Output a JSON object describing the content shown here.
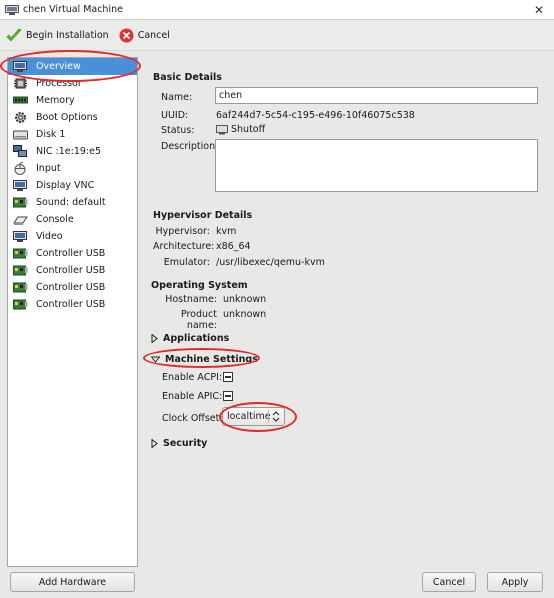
{
  "window": {
    "title": "chen Virtual Machine"
  },
  "toolbar": {
    "begin_label": "Begin Installation",
    "cancel_label": "Cancel"
  },
  "sidebar": {
    "items": [
      {
        "label": "Overview",
        "icon": "monitor-icon"
      },
      {
        "label": "Processor",
        "icon": "cpu-icon"
      },
      {
        "label": "Memory",
        "icon": "memory-icon"
      },
      {
        "label": "Boot Options",
        "icon": "gear-icon"
      },
      {
        "label": "Disk 1",
        "icon": "disk-icon"
      },
      {
        "label": "NIC :1e:19:e5",
        "icon": "network-icon"
      },
      {
        "label": "Input",
        "icon": "mouse-icon"
      },
      {
        "label": "Display VNC",
        "icon": "display-icon"
      },
      {
        "label": "Sound: default",
        "icon": "sound-card-icon"
      },
      {
        "label": "Console",
        "icon": "console-icon"
      },
      {
        "label": "Video",
        "icon": "video-icon"
      },
      {
        "label": "Controller USB",
        "icon": "usb-controller-icon"
      },
      {
        "label": "Controller USB",
        "icon": "usb-controller-icon"
      },
      {
        "label": "Controller USB",
        "icon": "usb-controller-icon"
      },
      {
        "label": "Controller USB",
        "icon": "usb-controller-icon"
      }
    ],
    "add_hardware_label": "Add Hardware"
  },
  "basic": {
    "header": "Basic Details",
    "name_label": "Name:",
    "name_value": "chen",
    "uuid_label": "UUID:",
    "uuid_value": "6af244d7-5c54-c195-e496-10f46075c538",
    "status_label": "Status:",
    "status_value": "Shutoff",
    "description_label": "Description:",
    "description_value": ""
  },
  "hypervisor": {
    "header": "Hypervisor Details",
    "hypervisor_label": "Hypervisor:",
    "hypervisor_value": "kvm",
    "arch_label": "Architecture:",
    "arch_value": "x86_64",
    "emulator_label": "Emulator:",
    "emulator_value": "/usr/libexec/qemu-kvm"
  },
  "os": {
    "header": "Operating System",
    "hostname_label": "Hostname:",
    "hostname_value": "unknown",
    "product_label": "Product name:",
    "product_value": "unknown"
  },
  "applications": {
    "label": "Applications"
  },
  "machine": {
    "label": "Machine Settings",
    "acpi_label": "Enable ACPI:",
    "apic_label": "Enable APIC:",
    "clock_label": "Clock Offset:",
    "clock_value": "localtime"
  },
  "security": {
    "label": "Security"
  },
  "footer": {
    "cancel_label": "Cancel",
    "apply_label": "Apply"
  },
  "colors": {
    "selection": "#4a90d9",
    "annotation": "#e02a2a",
    "ok_green": "#5cb82e",
    "cancel_red": "#e0303b"
  }
}
